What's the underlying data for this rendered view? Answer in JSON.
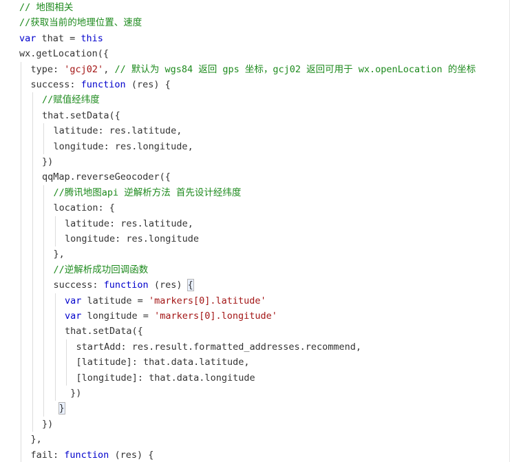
{
  "editor": {
    "lines": [
      {
        "indent": 0,
        "tokens": [
          {
            "t": "c",
            "v": "// 地图相关"
          }
        ]
      },
      {
        "indent": 0,
        "tokens": [
          {
            "t": "c",
            "v": "//获取当前的地理位置、速度"
          }
        ]
      },
      {
        "indent": 0,
        "tokens": [
          {
            "t": "k",
            "v": "var"
          },
          {
            "t": "i",
            "v": " that = "
          },
          {
            "t": "k",
            "v": "this"
          }
        ]
      },
      {
        "indent": 0,
        "tokens": [
          {
            "t": "i",
            "v": "wx.getLocation({"
          }
        ]
      },
      {
        "indent": 1,
        "tokens": [
          {
            "t": "i",
            "v": "type: "
          },
          {
            "t": "s",
            "v": "'gcj02'"
          },
          {
            "t": "i",
            "v": ", "
          },
          {
            "t": "c",
            "v": "// 默认为 wgs84 返回 gps 坐标，gcj02 返回可用于 wx.openLocation 的坐标"
          }
        ]
      },
      {
        "indent": 1,
        "tokens": [
          {
            "t": "i",
            "v": "success: "
          },
          {
            "t": "k",
            "v": "function"
          },
          {
            "t": "i",
            "v": " (res) {"
          }
        ]
      },
      {
        "indent": 2,
        "tokens": [
          {
            "t": "c",
            "v": "//赋值经纬度"
          }
        ]
      },
      {
        "indent": 2,
        "tokens": [
          {
            "t": "i",
            "v": "that.setData({"
          }
        ]
      },
      {
        "indent": 3,
        "tokens": [
          {
            "t": "i",
            "v": "latitude: res.latitude,"
          }
        ]
      },
      {
        "indent": 3,
        "tokens": [
          {
            "t": "i",
            "v": "longitude: res.longitude,"
          }
        ]
      },
      {
        "indent": 2,
        "tokens": [
          {
            "t": "i",
            "v": "})"
          }
        ]
      },
      {
        "indent": 2,
        "tokens": [
          {
            "t": "i",
            "v": "qqMap.reverseGeocoder({"
          }
        ]
      },
      {
        "indent": 3,
        "tokens": [
          {
            "t": "c",
            "v": "//腾讯地图api 逆解析方法 首先设计经纬度"
          }
        ]
      },
      {
        "indent": 3,
        "tokens": [
          {
            "t": "i",
            "v": "location: {"
          }
        ]
      },
      {
        "indent": 4,
        "tokens": [
          {
            "t": "i",
            "v": "latitude: res.latitude,"
          }
        ]
      },
      {
        "indent": 4,
        "tokens": [
          {
            "t": "i",
            "v": "longitude: res.longitude"
          }
        ]
      },
      {
        "indent": 3,
        "tokens": [
          {
            "t": "i",
            "v": "},"
          }
        ]
      },
      {
        "indent": 3,
        "tokens": [
          {
            "t": "c",
            "v": "//逆解析成功回调函数"
          }
        ]
      },
      {
        "indent": 3,
        "tokens": [
          {
            "t": "i",
            "v": "success: "
          },
          {
            "t": "k",
            "v": "function"
          },
          {
            "t": "i",
            "v": " (res) "
          },
          {
            "t": "b",
            "v": "{"
          }
        ]
      },
      {
        "indent": 4,
        "tokens": [
          {
            "t": "k",
            "v": "var"
          },
          {
            "t": "i",
            "v": " latitude = "
          },
          {
            "t": "s",
            "v": "'markers[0].latitude'"
          }
        ]
      },
      {
        "indent": 4,
        "tokens": [
          {
            "t": "k",
            "v": "var"
          },
          {
            "t": "i",
            "v": " longitude = "
          },
          {
            "t": "s",
            "v": "'markers[0].longitude'"
          }
        ]
      },
      {
        "indent": 4,
        "tokens": [
          {
            "t": "i",
            "v": "that.setData({"
          }
        ]
      },
      {
        "indent": 5,
        "tokens": [
          {
            "t": "i",
            "v": "startAdd: res.result.formatted_addresses.recommend,"
          }
        ]
      },
      {
        "indent": 5,
        "tokens": [
          {
            "t": "i",
            "v": "[latitude]: that.data.latitude,"
          }
        ]
      },
      {
        "indent": 5,
        "tokens": [
          {
            "t": "i",
            "v": "[longitude]: that.data.longitude"
          }
        ]
      },
      {
        "indent": 4,
        "tokens": [
          {
            "t": "i",
            "v": " })"
          }
        ]
      },
      {
        "indent": 3,
        "tokens": [
          {
            "t": "i",
            "v": " "
          },
          {
            "t": "b",
            "v": "}"
          }
        ]
      },
      {
        "indent": 2,
        "tokens": [
          {
            "t": "i",
            "v": "})"
          }
        ]
      },
      {
        "indent": 1,
        "tokens": [
          {
            "t": "i",
            "v": "},"
          }
        ]
      },
      {
        "indent": 1,
        "tokens": [
          {
            "t": "i",
            "v": "fail: "
          },
          {
            "t": "k",
            "v": "function"
          },
          {
            "t": "i",
            "v": " (res) {"
          }
        ]
      }
    ]
  }
}
